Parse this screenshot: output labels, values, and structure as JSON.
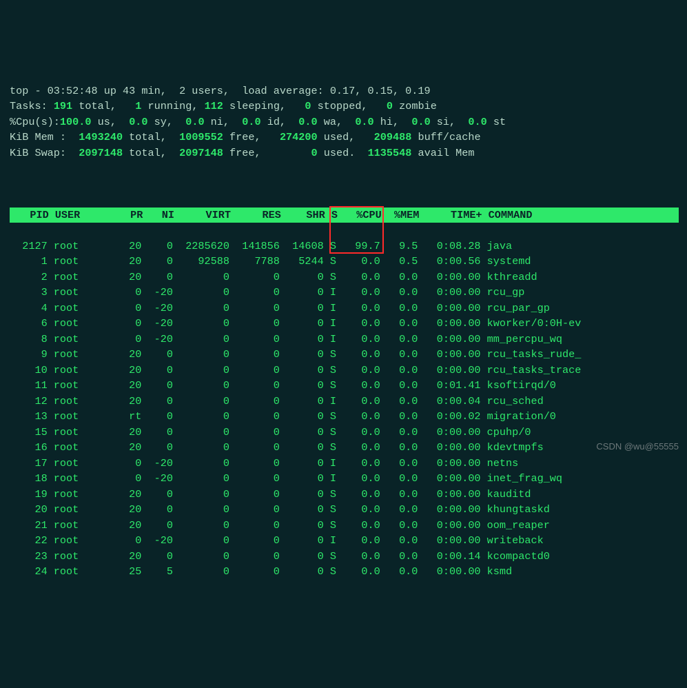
{
  "summary": {
    "line1": {
      "prefix": "top - ",
      "time": "03:52:48",
      "uptime": " up 43 min,  ",
      "users": "2",
      "users_lbl": " users,  load average: ",
      "lavg": "0.17, 0.15, 0.19"
    },
    "tasks": {
      "label": "Tasks: ",
      "total": "191",
      "running": "1",
      "sleeping": "112",
      "stopped": "0",
      "zombie": "0"
    },
    "cpu": {
      "label": "%Cpu(s):",
      "us": "100.0",
      "sy": "0.0",
      "ni": "0.0",
      "id": "0.0",
      "wa": "0.0",
      "hi": "0.0",
      "si": "0.0",
      "st": "0.0"
    },
    "mem": {
      "label": "KiB Mem : ",
      "total": "1493240",
      "free": "1009552",
      "used": "274200",
      "buff": "209488"
    },
    "swap": {
      "label": "KiB Swap: ",
      "total": "2097148",
      "free": "2097148",
      "used": "0",
      "avail": "1135548"
    }
  },
  "columns": [
    "PID",
    "USER",
    "PR",
    "NI",
    "VIRT",
    "RES",
    "SHR",
    "S",
    "%CPU",
    "%MEM",
    "TIME+",
    "COMMAND"
  ],
  "widths": [
    6,
    8,
    5,
    4,
    8,
    7,
    6,
    2,
    5,
    5,
    9,
    16
  ],
  "align": [
    "r",
    "l",
    "r",
    "r",
    "r",
    "r",
    "r",
    "l",
    "r",
    "r",
    "r",
    "l"
  ],
  "rows": [
    {
      "PID": "2127",
      "USER": "root",
      "PR": "20",
      "NI": "0",
      "VIRT": "2285620",
      "RES": "141856",
      "SHR": "14608",
      "S": "S",
      "%CPU": "99.7",
      "%MEM": "9.5",
      "TIME+": "0:08.28",
      "COMMAND": "java"
    },
    {
      "PID": "1",
      "USER": "root",
      "PR": "20",
      "NI": "0",
      "VIRT": "92588",
      "RES": "7788",
      "SHR": "5244",
      "S": "S",
      "%CPU": "0.0",
      "%MEM": "0.5",
      "TIME+": "0:00.56",
      "COMMAND": "systemd"
    },
    {
      "PID": "2",
      "USER": "root",
      "PR": "20",
      "NI": "0",
      "VIRT": "0",
      "RES": "0",
      "SHR": "0",
      "S": "S",
      "%CPU": "0.0",
      "%MEM": "0.0",
      "TIME+": "0:00.00",
      "COMMAND": "kthreadd"
    },
    {
      "PID": "3",
      "USER": "root",
      "PR": "0",
      "NI": "-20",
      "VIRT": "0",
      "RES": "0",
      "SHR": "0",
      "S": "I",
      "%CPU": "0.0",
      "%MEM": "0.0",
      "TIME+": "0:00.00",
      "COMMAND": "rcu_gp"
    },
    {
      "PID": "4",
      "USER": "root",
      "PR": "0",
      "NI": "-20",
      "VIRT": "0",
      "RES": "0",
      "SHR": "0",
      "S": "I",
      "%CPU": "0.0",
      "%MEM": "0.0",
      "TIME+": "0:00.00",
      "COMMAND": "rcu_par_gp"
    },
    {
      "PID": "6",
      "USER": "root",
      "PR": "0",
      "NI": "-20",
      "VIRT": "0",
      "RES": "0",
      "SHR": "0",
      "S": "I",
      "%CPU": "0.0",
      "%MEM": "0.0",
      "TIME+": "0:00.00",
      "COMMAND": "kworker/0:0H-ev"
    },
    {
      "PID": "8",
      "USER": "root",
      "PR": "0",
      "NI": "-20",
      "VIRT": "0",
      "RES": "0",
      "SHR": "0",
      "S": "I",
      "%CPU": "0.0",
      "%MEM": "0.0",
      "TIME+": "0:00.00",
      "COMMAND": "mm_percpu_wq"
    },
    {
      "PID": "9",
      "USER": "root",
      "PR": "20",
      "NI": "0",
      "VIRT": "0",
      "RES": "0",
      "SHR": "0",
      "S": "S",
      "%CPU": "0.0",
      "%MEM": "0.0",
      "TIME+": "0:00.00",
      "COMMAND": "rcu_tasks_rude_"
    },
    {
      "PID": "10",
      "USER": "root",
      "PR": "20",
      "NI": "0",
      "VIRT": "0",
      "RES": "0",
      "SHR": "0",
      "S": "S",
      "%CPU": "0.0",
      "%MEM": "0.0",
      "TIME+": "0:00.00",
      "COMMAND": "rcu_tasks_trace"
    },
    {
      "PID": "11",
      "USER": "root",
      "PR": "20",
      "NI": "0",
      "VIRT": "0",
      "RES": "0",
      "SHR": "0",
      "S": "S",
      "%CPU": "0.0",
      "%MEM": "0.0",
      "TIME+": "0:01.41",
      "COMMAND": "ksoftirqd/0"
    },
    {
      "PID": "12",
      "USER": "root",
      "PR": "20",
      "NI": "0",
      "VIRT": "0",
      "RES": "0",
      "SHR": "0",
      "S": "I",
      "%CPU": "0.0",
      "%MEM": "0.0",
      "TIME+": "0:00.04",
      "COMMAND": "rcu_sched"
    },
    {
      "PID": "13",
      "USER": "root",
      "PR": "rt",
      "NI": "0",
      "VIRT": "0",
      "RES": "0",
      "SHR": "0",
      "S": "S",
      "%CPU": "0.0",
      "%MEM": "0.0",
      "TIME+": "0:00.02",
      "COMMAND": "migration/0"
    },
    {
      "PID": "15",
      "USER": "root",
      "PR": "20",
      "NI": "0",
      "VIRT": "0",
      "RES": "0",
      "SHR": "0",
      "S": "S",
      "%CPU": "0.0",
      "%MEM": "0.0",
      "TIME+": "0:00.00",
      "COMMAND": "cpuhp/0"
    },
    {
      "PID": "16",
      "USER": "root",
      "PR": "20",
      "NI": "0",
      "VIRT": "0",
      "RES": "0",
      "SHR": "0",
      "S": "S",
      "%CPU": "0.0",
      "%MEM": "0.0",
      "TIME+": "0:00.00",
      "COMMAND": "kdevtmpfs"
    },
    {
      "PID": "17",
      "USER": "root",
      "PR": "0",
      "NI": "-20",
      "VIRT": "0",
      "RES": "0",
      "SHR": "0",
      "S": "I",
      "%CPU": "0.0",
      "%MEM": "0.0",
      "TIME+": "0:00.00",
      "COMMAND": "netns"
    },
    {
      "PID": "18",
      "USER": "root",
      "PR": "0",
      "NI": "-20",
      "VIRT": "0",
      "RES": "0",
      "SHR": "0",
      "S": "I",
      "%CPU": "0.0",
      "%MEM": "0.0",
      "TIME+": "0:00.00",
      "COMMAND": "inet_frag_wq"
    },
    {
      "PID": "19",
      "USER": "root",
      "PR": "20",
      "NI": "0",
      "VIRT": "0",
      "RES": "0",
      "SHR": "0",
      "S": "S",
      "%CPU": "0.0",
      "%MEM": "0.0",
      "TIME+": "0:00.00",
      "COMMAND": "kauditd"
    },
    {
      "PID": "20",
      "USER": "root",
      "PR": "20",
      "NI": "0",
      "VIRT": "0",
      "RES": "0",
      "SHR": "0",
      "S": "S",
      "%CPU": "0.0",
      "%MEM": "0.0",
      "TIME+": "0:00.00",
      "COMMAND": "khungtaskd"
    },
    {
      "PID": "21",
      "USER": "root",
      "PR": "20",
      "NI": "0",
      "VIRT": "0",
      "RES": "0",
      "SHR": "0",
      "S": "S",
      "%CPU": "0.0",
      "%MEM": "0.0",
      "TIME+": "0:00.00",
      "COMMAND": "oom_reaper"
    },
    {
      "PID": "22",
      "USER": "root",
      "PR": "0",
      "NI": "-20",
      "VIRT": "0",
      "RES": "0",
      "SHR": "0",
      "S": "I",
      "%CPU": "0.0",
      "%MEM": "0.0",
      "TIME+": "0:00.00",
      "COMMAND": "writeback"
    },
    {
      "PID": "23",
      "USER": "root",
      "PR": "20",
      "NI": "0",
      "VIRT": "0",
      "RES": "0",
      "SHR": "0",
      "S": "S",
      "%CPU": "0.0",
      "%MEM": "0.0",
      "TIME+": "0:00.14",
      "COMMAND": "kcompactd0"
    },
    {
      "PID": "24",
      "USER": "root",
      "PR": "25",
      "NI": "5",
      "VIRT": "0",
      "RES": "0",
      "SHR": "0",
      "S": "S",
      "%CPU": "0.0",
      "%MEM": "0.0",
      "TIME+": "0:00.00",
      "COMMAND": "ksmd"
    }
  ],
  "highlight": {
    "row_index": 0,
    "from_col": "S",
    "to_col": "%CPU"
  },
  "watermark": "CSDN @wu@55555"
}
